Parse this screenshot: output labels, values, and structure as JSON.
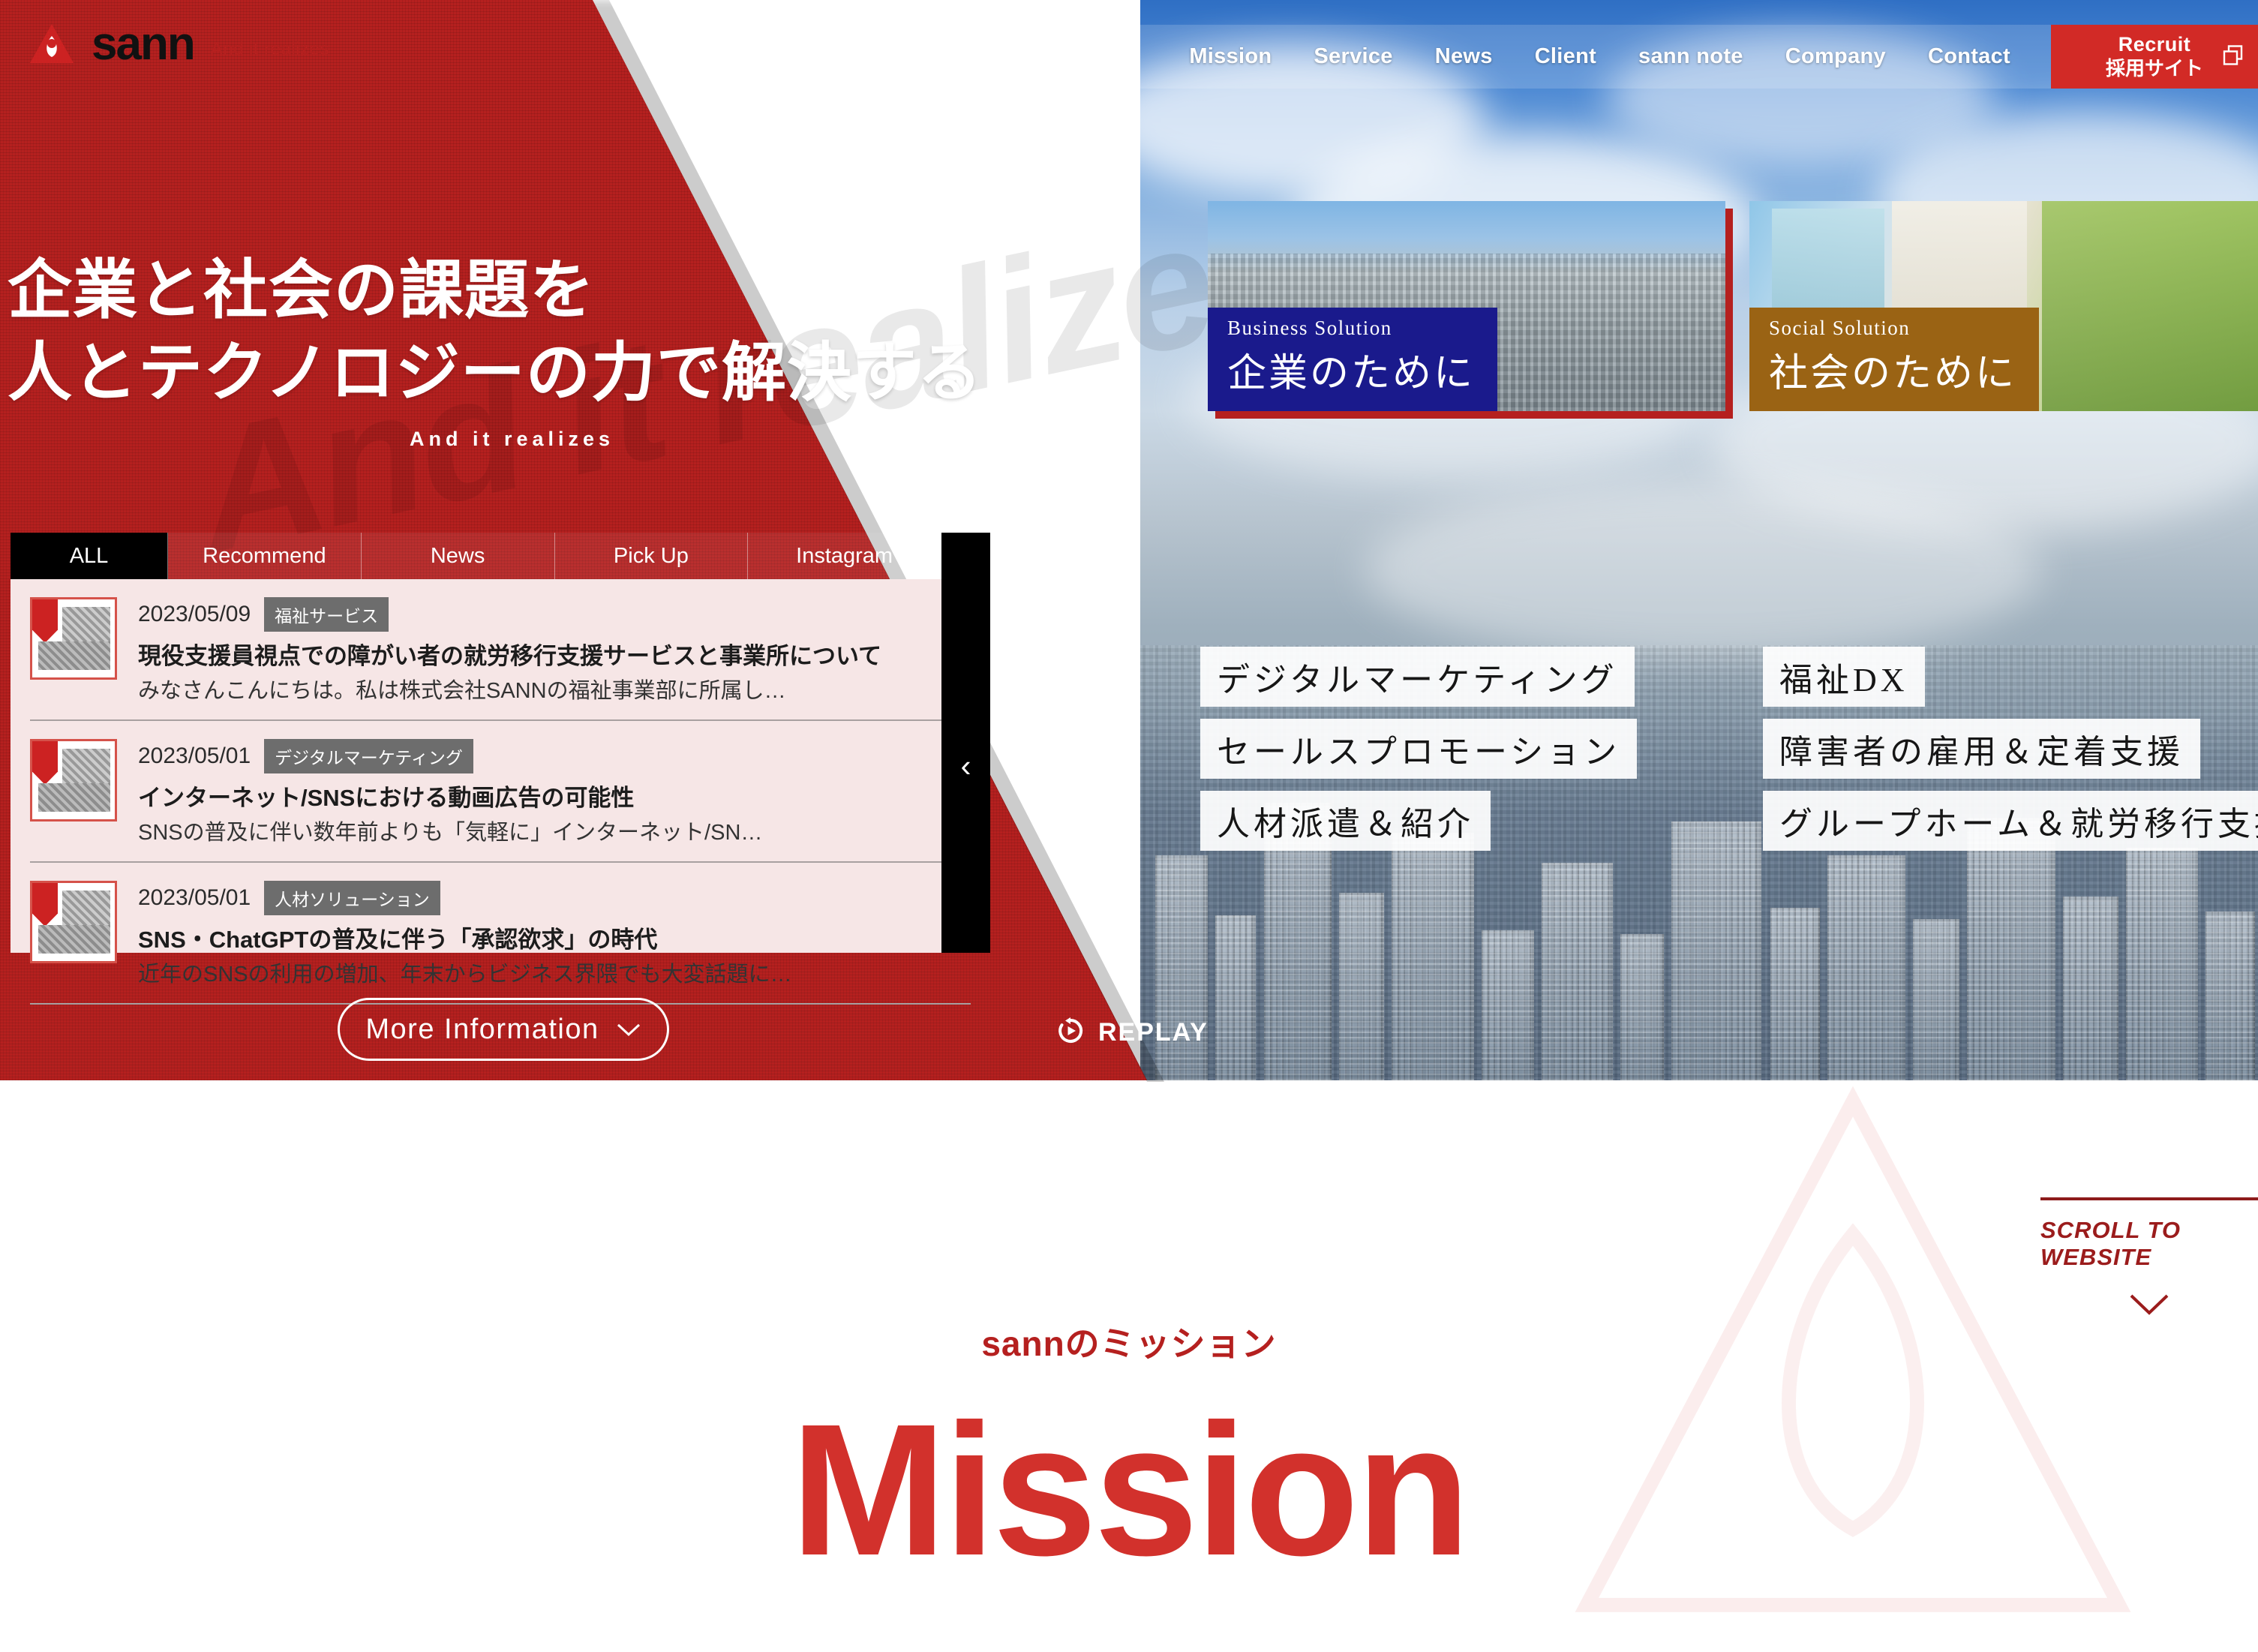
{
  "brand": {
    "name": "sann",
    "tagline": "And it realizes",
    "logo_icon": "sann-triangle-logo",
    "accent_red": "#b5201f",
    "mark_red": "#d2312c"
  },
  "nav": {
    "items": [
      {
        "label": "Mission"
      },
      {
        "label": "Service"
      },
      {
        "label": "News"
      },
      {
        "label": "Client"
      },
      {
        "label": "sann note"
      },
      {
        "label": "Company"
      },
      {
        "label": "Contact"
      }
    ],
    "recruit": {
      "en": "Recruit",
      "jp": "採用サイト",
      "icon": "external-link-icon"
    }
  },
  "hero": {
    "headline_line1": "企業と社会の課題を",
    "headline_line2": "人とテクノロジーの力で解決する",
    "subtitle": "And it realizes",
    "watermark": "And it realizes",
    "replay": {
      "label": "REPLAY",
      "icon": "replay-icon"
    }
  },
  "news": {
    "tabs": [
      {
        "label": "ALL",
        "active": true
      },
      {
        "label": "Recommend",
        "active": false
      },
      {
        "label": "News",
        "active": false
      },
      {
        "label": "Pick Up",
        "active": false
      },
      {
        "label": "Instagram",
        "active": false
      }
    ],
    "scroll_prev_icon": "chevron-left-icon",
    "items": [
      {
        "date": "2023/05/09",
        "category": "福祉サービス",
        "title": "現役支援員視点での障がい者の就労移行支援サービスと事業所について",
        "excerpt": "みなさんこんにちは。私は株式会社SANNの福祉事業部に所属し…",
        "thumb": "article-thumbnail-welfare"
      },
      {
        "date": "2023/05/01",
        "category": "デジタルマーケティング",
        "title": "インターネット/SNSにおける動画広告の可能性",
        "excerpt": "SNSの普及に伴い数年前よりも「気軽に」インターネット/SN…",
        "thumb": "article-thumbnail-digital-marketing"
      },
      {
        "date": "2023/05/01",
        "category": "人材ソリューション",
        "title": "SNS・ChatGPTの普及に伴う「承認欲求」の時代",
        "excerpt": "近年のSNSの利用の増加、年末からビジネス界隈でも大変話題に…",
        "thumb": "article-thumbnail-hr-solution"
      }
    ],
    "more_button": {
      "label": "More Information",
      "icon": "chevron-down-icon"
    }
  },
  "solutions": [
    {
      "en": "Business Solution",
      "jp": "企業のために",
      "badge_color": "#1a1a8c",
      "image": "tokyo-cityscape-photo",
      "tags": [
        "デジタルマーケティング",
        "セールスプロモーション",
        "人材派遣＆紹介"
      ]
    },
    {
      "en": "Social Solution",
      "jp": "社会のために",
      "badge_color": "#9a6314",
      "image": "caregiver-wheelchair-photo",
      "tags": [
        "福祉DX",
        "障害者の雇用＆定着支援",
        "グループホーム＆就労移行支援"
      ]
    }
  ],
  "scroll_indicator": {
    "label": "SCROLL TO WEBSITE",
    "icon": "chevron-down-icon"
  },
  "mission": {
    "jp": "sannのミッション",
    "en": "Mission"
  }
}
